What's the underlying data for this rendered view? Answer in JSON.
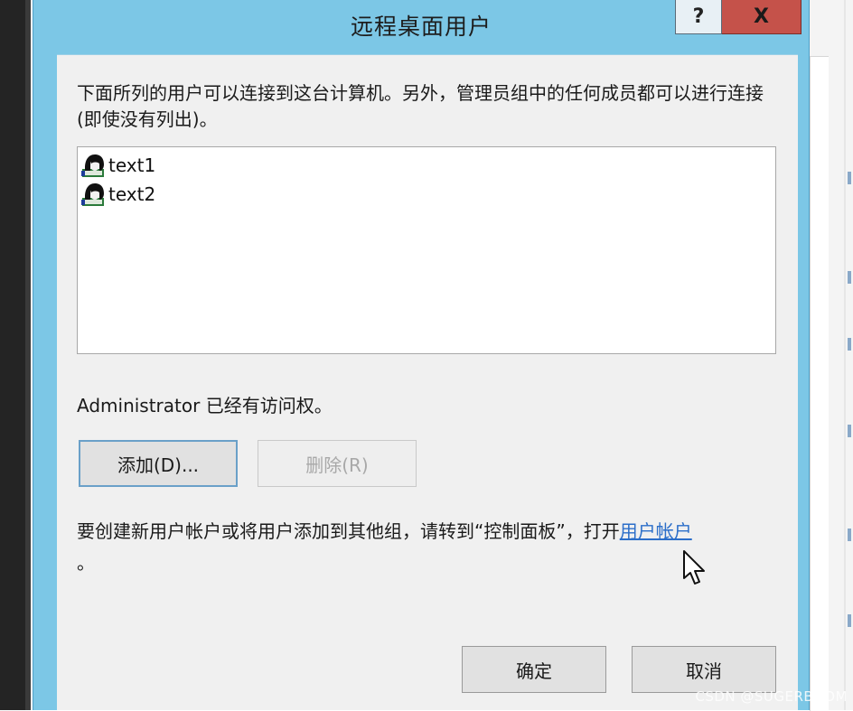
{
  "window": {
    "title": "远程桌面用户",
    "help_label": "?",
    "close_label": "X"
  },
  "description": "下面所列的用户可以连接到这台计算机。另外，管理员组中的任何成员都可以进行连接(即使没有列出)。",
  "users": [
    {
      "name": "text1",
      "icon": "user-icon"
    },
    {
      "name": "text2",
      "icon": "user-icon"
    }
  ],
  "admin_note": "Administrator 已经有访问权。",
  "buttons": {
    "add": "添加(D)...",
    "remove": "删除(R)",
    "ok": "确定",
    "cancel": "取消"
  },
  "info": {
    "text": "要创建新用户帐户或将用户添加到其他组，请转到“控制面板”，打开",
    "link": "用户帐户",
    "suffix": "。"
  },
  "watermark": "CSDN @SUGERBOOM",
  "colors": {
    "titlebar": "#7cc7e6",
    "close": "#c5524a",
    "link": "#2b6ec9"
  }
}
